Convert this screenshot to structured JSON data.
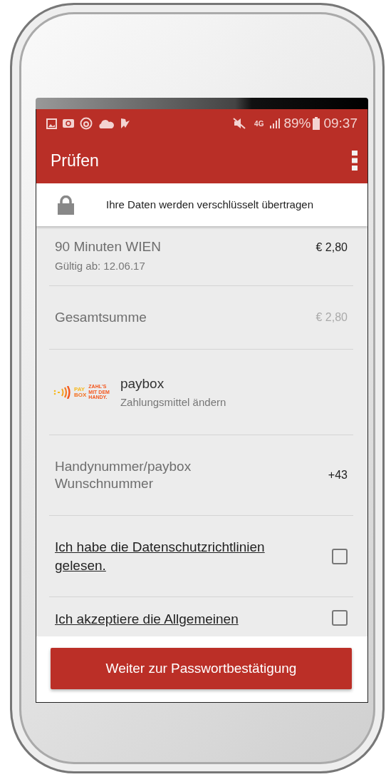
{
  "status_bar": {
    "network": "4G",
    "battery": "89%",
    "time": "09:37"
  },
  "toolbar": {
    "title": "Prüfen"
  },
  "security_banner": {
    "text": "Ihre Daten werden verschlüsselt übertragen"
  },
  "ticket": {
    "name": "90 Minuten WIEN",
    "valid_from": "Gültig ab: 12.06.17",
    "price": "€ 2,80"
  },
  "total": {
    "label": "Gesamtsumme",
    "amount": "€ 2,80"
  },
  "payment": {
    "logo": {
      "line1": "PAY",
      "line2": "BOX",
      "slogan": [
        "ZAHL'S",
        "MIT DEM",
        "HANDY."
      ]
    },
    "name": "paybox",
    "action": "Zahlungsmittel ändern"
  },
  "phone_number": {
    "label": "Handynummer/paybox Wunschnummer",
    "value": "+43"
  },
  "consents": [
    {
      "text": "Ich habe die Datenschutzrichtlinien gelesen.",
      "checked": false
    },
    {
      "text": "Ich akzeptiere die Allgemeinen",
      "checked": false
    }
  ],
  "primary_button": {
    "label": "Weiter zur Passwortbestätigung"
  }
}
